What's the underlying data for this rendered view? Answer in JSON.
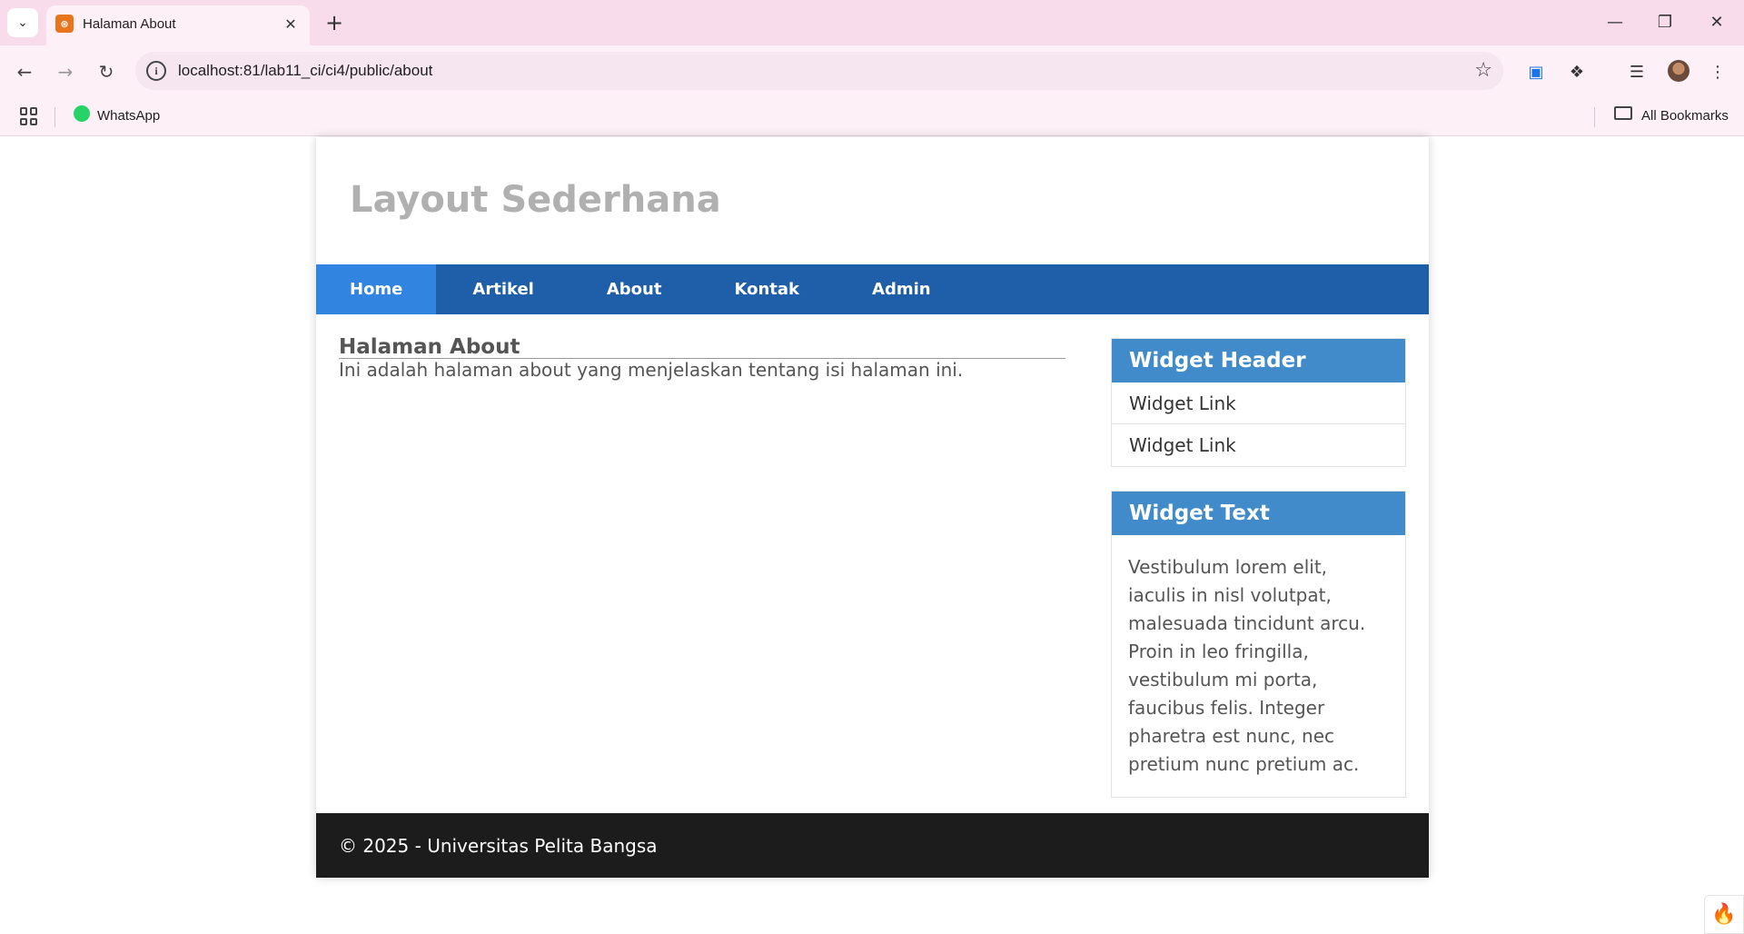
{
  "browser": {
    "tab_title": "Halaman About",
    "url": "localhost:81/lab11_ci/ci4/public/about",
    "bookmarks": [
      {
        "label": "WhatsApp",
        "icon": "whatsapp-icon"
      }
    ],
    "all_bookmarks_label": "All Bookmarks",
    "theme_color": "#f8dcec"
  },
  "site": {
    "title": "Layout Sederhana",
    "nav": [
      {
        "label": "Home",
        "active": true
      },
      {
        "label": "Artikel",
        "active": false
      },
      {
        "label": "About",
        "active": false
      },
      {
        "label": "Kontak",
        "active": false
      },
      {
        "label": "Admin",
        "active": false
      }
    ],
    "nav_color": "#1f5faa",
    "nav_active_color": "#3185e0"
  },
  "content": {
    "title": "Halaman About",
    "text": "Ini adalah halaman about yang menjelaskan tentang isi halaman ini."
  },
  "sidebar": {
    "widget_links": {
      "header": "Widget Header",
      "links": [
        "Widget Link",
        "Widget Link"
      ]
    },
    "widget_text": {
      "header": "Widget Text",
      "body": "Vestibulum lorem elit, iaculis in nisl volutpat, malesuada tincidunt arcu. Proin in leo fringilla, vestibulum mi porta, faucibus felis. Integer pharetra est nunc, nec pretium nunc pretium ac."
    },
    "widget_header_color": "#428bca"
  },
  "footer": {
    "text": "© 2025 - Universitas Pelita Bangsa",
    "color": "#1c1c1c"
  }
}
